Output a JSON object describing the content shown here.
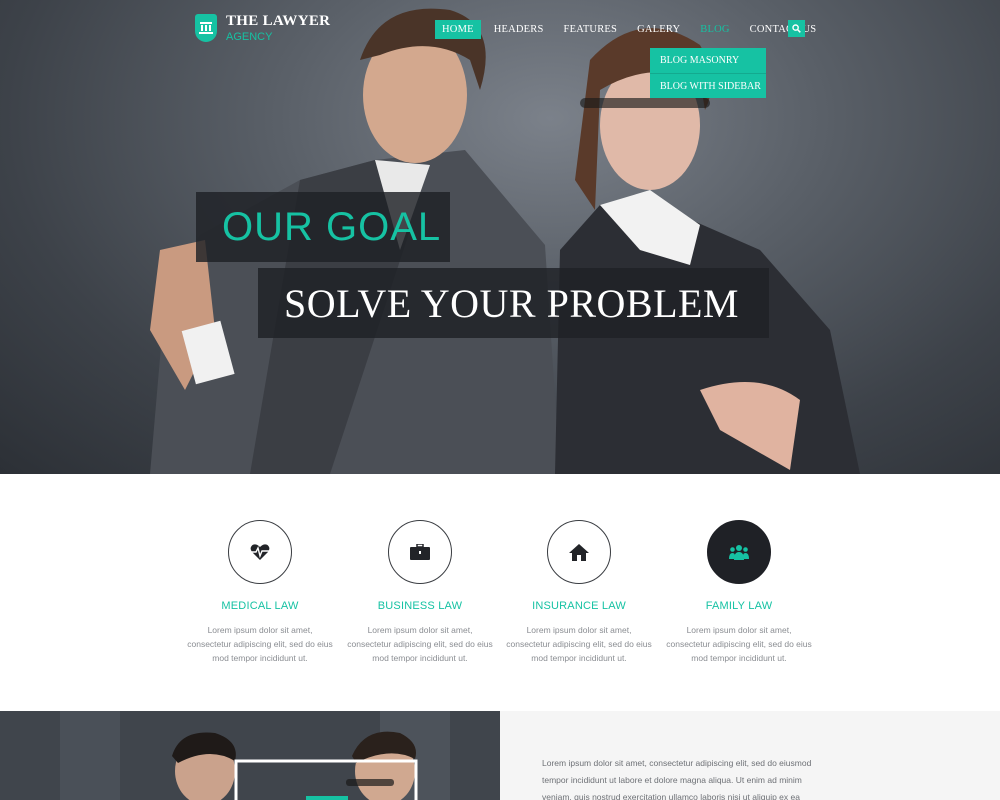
{
  "brand": {
    "title": "THE LAWYER",
    "subtitle": "AGENCY",
    "icon": "courthouse-icon"
  },
  "nav": {
    "items": [
      {
        "label": "HOME",
        "active": true
      },
      {
        "label": "HEADERS"
      },
      {
        "label": "FEATURES"
      },
      {
        "label": "GALERY"
      },
      {
        "label": "BLOG",
        "highlight": true
      },
      {
        "label": "CONTACT US"
      }
    ],
    "search_icon": "search-icon"
  },
  "dropdown": {
    "items": [
      "BLOG MASONRY",
      "BLOG WITH SIDEBAR"
    ]
  },
  "hero": {
    "heading": "OUR GOAL",
    "subheading": "SOLVE YOUR PROBLEM"
  },
  "services": [
    {
      "icon": "heartbeat-icon",
      "title": "MEDICAL LAW",
      "text": "Lorem ipsum dolor sit amet, consectetur adipiscing elit, sed do eius mod tempor incididunt ut."
    },
    {
      "icon": "briefcase-icon",
      "title": "BUSINESS LAW",
      "text": "Lorem ipsum dolor sit amet, consectetur adipiscing elit, sed do eius mod tempor incididunt ut."
    },
    {
      "icon": "home-icon",
      "title": "INSURANCE LAW",
      "text": "Lorem ipsum dolor sit amet, consectetur adipiscing elit, sed do eius mod tempor incididunt ut."
    },
    {
      "icon": "family-icon",
      "title": "FAMILY LAW",
      "text": "Lorem ipsum dolor sit amet, consectetur adipiscing elit, sed do eius mod tempor incididunt ut."
    }
  ],
  "about": {
    "text": "Lorem ipsum dolor sit amet, consectetur adipiscing elit, sed do eiusmod tempor incididunt ut labore et dolore magna aliqua. Ut enim ad minim veniam, quis nostrud exercitation ullamco laboris nisi ut aliquip ex ea"
  },
  "colors": {
    "accent": "#16c2a3",
    "dark": "#1f2126",
    "text_muted": "#8a8d92"
  }
}
